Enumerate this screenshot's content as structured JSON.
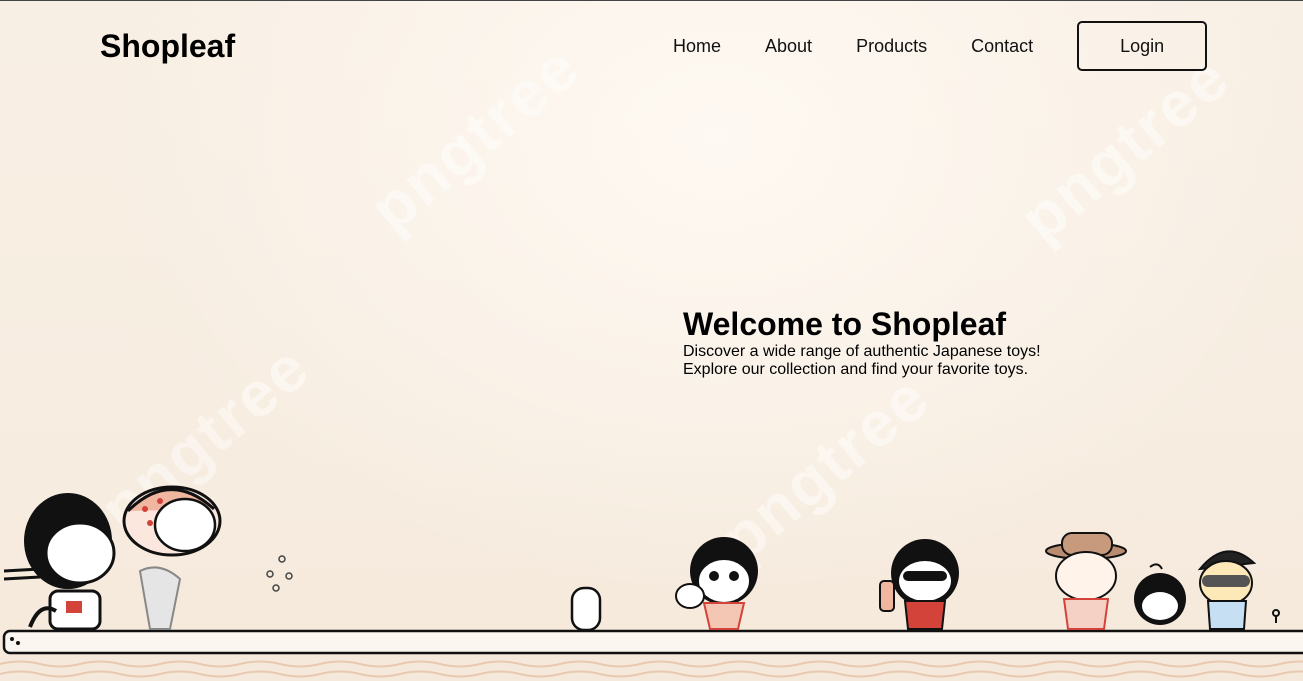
{
  "header": {
    "brand": "Shopleaf",
    "nav": [
      "Home",
      "About",
      "Products",
      "Contact"
    ],
    "login_label": "Login"
  },
  "hero": {
    "title": "Welcome to Shopleaf",
    "description": "Discover a wide range of authentic Japanese toys! Explore our collection and find your favorite toys."
  },
  "colors": {
    "background": "#f7eee2",
    "text": "#000000",
    "button_border": "#111111"
  }
}
